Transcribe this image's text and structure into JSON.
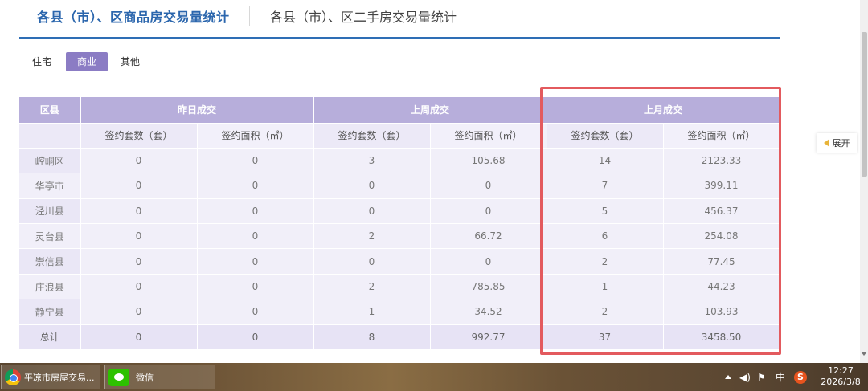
{
  "header": {
    "tab_main": "各县（市）、区商品房交易量统计",
    "tab_second": "各县（市）、区二手房交易量统计"
  },
  "categories": [
    {
      "label": "住宅",
      "active": false
    },
    {
      "label": "商业",
      "active": true
    },
    {
      "label": "其他",
      "active": false
    }
  ],
  "table": {
    "district_header": "区县",
    "groups": [
      "昨日成交",
      "上周成交",
      "上月成交"
    ],
    "sub_count": "签约套数（套）",
    "sub_area": "签约面积（㎡）",
    "rows": [
      {
        "district": "崆峒区",
        "y_count": "0",
        "y_area": "0",
        "w_count": "3",
        "w_area": "105.68",
        "m_count": "14",
        "m_area": "2123.33"
      },
      {
        "district": "华亭市",
        "y_count": "0",
        "y_area": "0",
        "w_count": "0",
        "w_area": "0",
        "m_count": "7",
        "m_area": "399.11"
      },
      {
        "district": "泾川县",
        "y_count": "0",
        "y_area": "0",
        "w_count": "0",
        "w_area": "0",
        "m_count": "5",
        "m_area": "456.37"
      },
      {
        "district": "灵台县",
        "y_count": "0",
        "y_area": "0",
        "w_count": "2",
        "w_area": "66.72",
        "m_count": "6",
        "m_area": "254.08"
      },
      {
        "district": "崇信县",
        "y_count": "0",
        "y_area": "0",
        "w_count": "0",
        "w_area": "0",
        "m_count": "2",
        "m_area": "77.45"
      },
      {
        "district": "庄浪县",
        "y_count": "0",
        "y_area": "0",
        "w_count": "2",
        "w_area": "785.85",
        "m_count": "1",
        "m_area": "44.23"
      },
      {
        "district": "静宁县",
        "y_count": "0",
        "y_area": "0",
        "w_count": "1",
        "w_area": "34.52",
        "m_count": "2",
        "m_area": "103.93"
      }
    ],
    "total": {
      "district": "总计",
      "y_count": "0",
      "y_area": "0",
      "w_count": "8",
      "w_area": "992.77",
      "m_count": "37",
      "m_area": "3458.50"
    }
  },
  "expand_label": "展开",
  "taskbar": {
    "items": [
      {
        "label": "平凉市房屋交易...",
        "icon": "chrome-icon"
      },
      {
        "label": "微信",
        "icon": "wechat-icon"
      }
    ],
    "tray_ime": "中",
    "tray_sogou": "S",
    "time": "12:27",
    "date": "2026/3/8"
  },
  "colors": {
    "accent_blue": "#2b66ad",
    "active_tab": "#8b7cc4",
    "table_header": "#b7aedb",
    "highlight_border": "#e35a5e"
  }
}
